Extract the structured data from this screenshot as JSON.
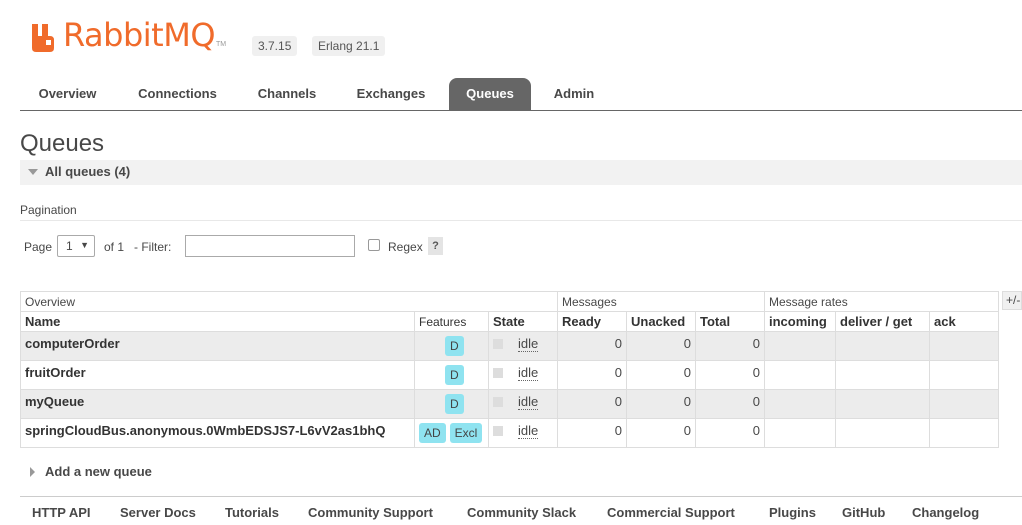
{
  "header": {
    "logo_text": "RabbitMQ",
    "logo_tm": "TM",
    "version": "3.7.15",
    "erlang": "Erlang 21.1",
    "brand_color": "#f06b2b"
  },
  "tabs": [
    {
      "label": "Overview",
      "active": false
    },
    {
      "label": "Connections",
      "active": false
    },
    {
      "label": "Channels",
      "active": false
    },
    {
      "label": "Exchanges",
      "active": false
    },
    {
      "label": "Queues",
      "active": true
    },
    {
      "label": "Admin",
      "active": false
    }
  ],
  "page_title": "Queues",
  "section_label": "All queues (4)",
  "pagination": {
    "label": "Pagination",
    "page_label": "Page",
    "page_value": "1",
    "of_label": "of 1",
    "filter_label": "- Filter:",
    "filter_value": "",
    "regex_label": "Regex",
    "regex_checked": false,
    "help": "?"
  },
  "table": {
    "groups": {
      "overview": "Overview",
      "messages": "Messages",
      "rates": "Message rates"
    },
    "columns": {
      "name": "Name",
      "features": "Features",
      "state": "State",
      "ready": "Ready",
      "unacked": "Unacked",
      "total": "Total",
      "incoming": "incoming",
      "deliver_get": "deliver / get",
      "ack": "ack"
    },
    "plus_minus": "+/-",
    "rows": [
      {
        "name": "computerOrder",
        "features": [
          "D"
        ],
        "state": "idle",
        "ready": "0",
        "unacked": "0",
        "total": "0",
        "incoming": "",
        "deliver_get": "",
        "ack": ""
      },
      {
        "name": "fruitOrder",
        "features": [
          "D"
        ],
        "state": "idle",
        "ready": "0",
        "unacked": "0",
        "total": "0",
        "incoming": "",
        "deliver_get": "",
        "ack": ""
      },
      {
        "name": "myQueue",
        "features": [
          "D"
        ],
        "state": "idle",
        "ready": "0",
        "unacked": "0",
        "total": "0",
        "incoming": "",
        "deliver_get": "",
        "ack": ""
      },
      {
        "name": "springCloudBus.anonymous.0WmbEDSJS7-L6vV2as1bhQ",
        "features": [
          "AD",
          "Excl"
        ],
        "state": "idle",
        "ready": "0",
        "unacked": "0",
        "total": "0",
        "incoming": "",
        "deliver_get": "",
        "ack": ""
      }
    ]
  },
  "add_queue_label": "Add a new queue",
  "footer_links": [
    "HTTP API",
    "Server Docs",
    "Tutorials",
    "Community Support",
    "Community Slack",
    "Commercial Support",
    "Plugins",
    "GitHub",
    "Changelog"
  ]
}
